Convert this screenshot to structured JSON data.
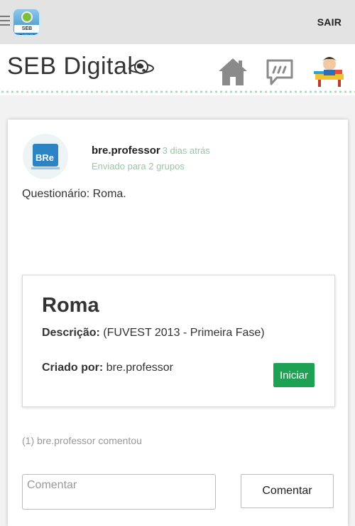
{
  "header": {
    "logout_label": "SAIR",
    "app_logo_label": "SEB Digital"
  },
  "brand": {
    "title": "SEB Digital",
    "icons": [
      "globe-icon",
      "home-icon",
      "chat-icon",
      "kid-avatar-icon"
    ]
  },
  "post": {
    "author": "bre.professor",
    "time": "3 dias atrás",
    "sent_to": "Enviado para 2 grupos",
    "body": "Questionário: Roma."
  },
  "quiz": {
    "title": "Roma",
    "description_label": "Descrição:",
    "description_value": "(FUVEST 2013 - Primeira Fase)",
    "created_by_label": "Criado por:",
    "created_by_value": "bre.professor",
    "start_label": "Iniciar"
  },
  "comments": {
    "summary": "(1) bre.professor comentou",
    "input_placeholder": "Comentar",
    "submit_label": "Comentar"
  },
  "colors": {
    "accent_green": "#1ea152",
    "muted_green": "#98c7a4",
    "topbar": "#e3e3e3"
  }
}
